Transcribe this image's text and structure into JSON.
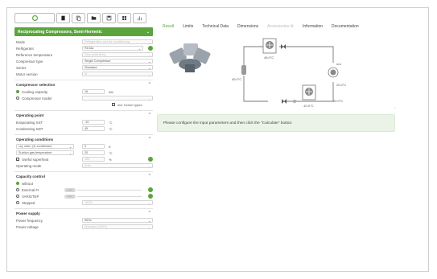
{
  "toolbar": {
    "buttons": [
      "play-icon",
      "file-icon",
      "copy-icon",
      "folder-icon",
      "save-icon",
      "grid-icon",
      "bar-chart-icon"
    ]
  },
  "product": {
    "label": "Reciprocating Compressors, Semi-Hermetic",
    "chevron": "⌄"
  },
  "general": {
    "mode_label": "Mode",
    "mode_value": "Refrigeration and Air conditioning",
    "refrigerant_label": "Refrigerant",
    "refrigerant_value": "R134a",
    "reftemp_label": "Reference temperature",
    "reftemp_value": "Dew point temp.",
    "comptype_label": "Compressor type",
    "comptype_value": "Single Compressor",
    "series_label": "Series",
    "series_value": "Standard",
    "motor_label": "Motor version",
    "motor_value": "M"
  },
  "compressor_selection": {
    "title": "Compressor selection",
    "cooling_label": "Cooling capacity",
    "cooling_value": "16",
    "cooling_unit": "kW",
    "model_label": "Compressor model",
    "former_label": "incl. former types"
  },
  "operating_point": {
    "title": "Operating point",
    "evap_label": "Evaporating SST",
    "evap_value": "-10",
    "evap_unit": "°C",
    "cond_label": "Condensing SDT",
    "cond_value": "45",
    "cond_unit": "°C"
  },
  "operating_conditions": {
    "title": "Operating conditions",
    "liq_label": "Liq. subc. (in condenser)",
    "liq_value": "0",
    "liq_unit": "K",
    "suction_label": "Suction gas temperature",
    "suction_value": "20",
    "suction_unit": "°C",
    "useful_label": "Useful superheat",
    "useful_value": "100",
    "useful_unit": "%",
    "mode_label": "Operating mode",
    "mode_value": "Auto"
  },
  "capacity_control": {
    "title": "Capacity control",
    "without_label": "without",
    "external_label": "External FI",
    "external_toggle": "Auto",
    "varistep_label": "VARISTEP",
    "varistep_toggle": "Auto",
    "stepped_label": "Stepped",
    "stepped_value": "100%"
  },
  "power_supply": {
    "title": "Power supply",
    "freq_label": "Power frequency",
    "freq_value": "50Hz",
    "voltage_label": "Power voltage",
    "voltage_value": "Standard (400V)"
  },
  "tabs": [
    "Result",
    "Limits",
    "Technical Data",
    "Dimensions",
    "Accessories",
    "Information",
    "Documentation"
  ],
  "diagram": {
    "t_cond": "45.0°C",
    "t_left": "45.0°C",
    "t_right_top": "20.0°C",
    "t_right_bottom": "20.0°C",
    "t_evap": "-10.0°C",
    "t_fan_label": "n/a"
  },
  "message": "Please configure the input parameters and then click the \"Calculate\" button.",
  "colors": {
    "accent": "#5ba43e",
    "msg_bg": "#eaf3e6"
  }
}
